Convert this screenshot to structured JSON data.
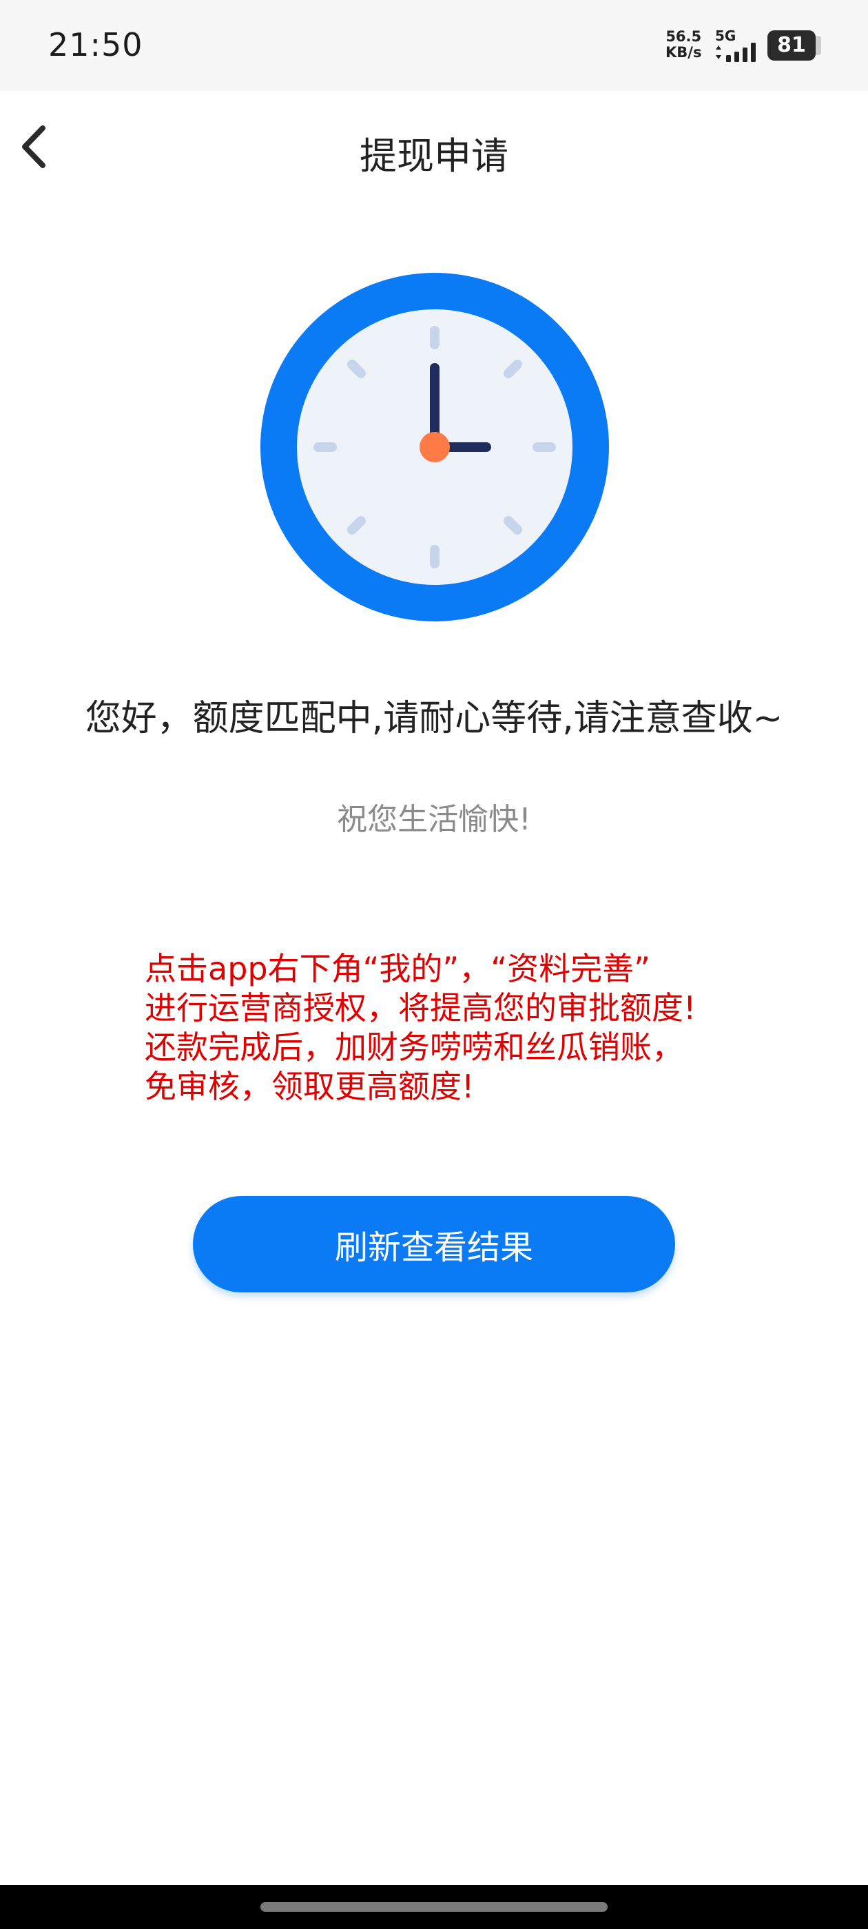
{
  "status_bar": {
    "time": "21:50",
    "net_speed_value": "56.5",
    "net_speed_unit": "KB/s",
    "network_type": "5G",
    "battery_level": "81"
  },
  "nav": {
    "title": "提现申请",
    "back_icon": "chevron-left-icon"
  },
  "content": {
    "clock_icon": "clock-icon",
    "main_message": "您好，额度匹配中,请耐心等待,请注意查收~",
    "sub_message": "祝您生活愉快!",
    "notice_lines": [
      "点击app右下角“我的”，“资料完善”",
      "进行运营商授权，将提高您的审批额度!",
      "还款完成后，加财务唠唠和丝瓜销账，",
      "免审核，领取更高额度!"
    ],
    "notice_color": "#e00000"
  },
  "refresh_button": {
    "label": "刷新查看结果"
  },
  "colors": {
    "accent": "#0a7af5",
    "clock_face": "#eef3fa",
    "clock_hand": "#1f2d5c",
    "clock_center": "#ff7a45"
  }
}
